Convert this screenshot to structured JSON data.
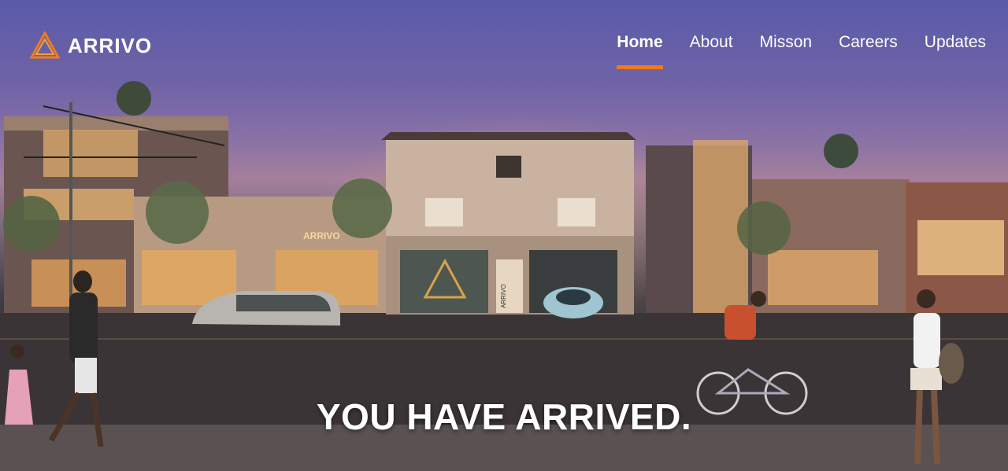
{
  "header": {
    "brand_name": "ARRIVO",
    "brand_color": "#f27a1a"
  },
  "nav": {
    "items": [
      {
        "label": "Home",
        "active": true
      },
      {
        "label": "About",
        "active": false
      },
      {
        "label": "Misson",
        "active": false
      },
      {
        "label": "Careers",
        "active": false
      },
      {
        "label": "Updates",
        "active": false
      }
    ]
  },
  "hero": {
    "headline": "YOU HAVE ARRIVED.",
    "storefront_sign": "ARRIVO",
    "door_sign": "ARRIVO"
  }
}
